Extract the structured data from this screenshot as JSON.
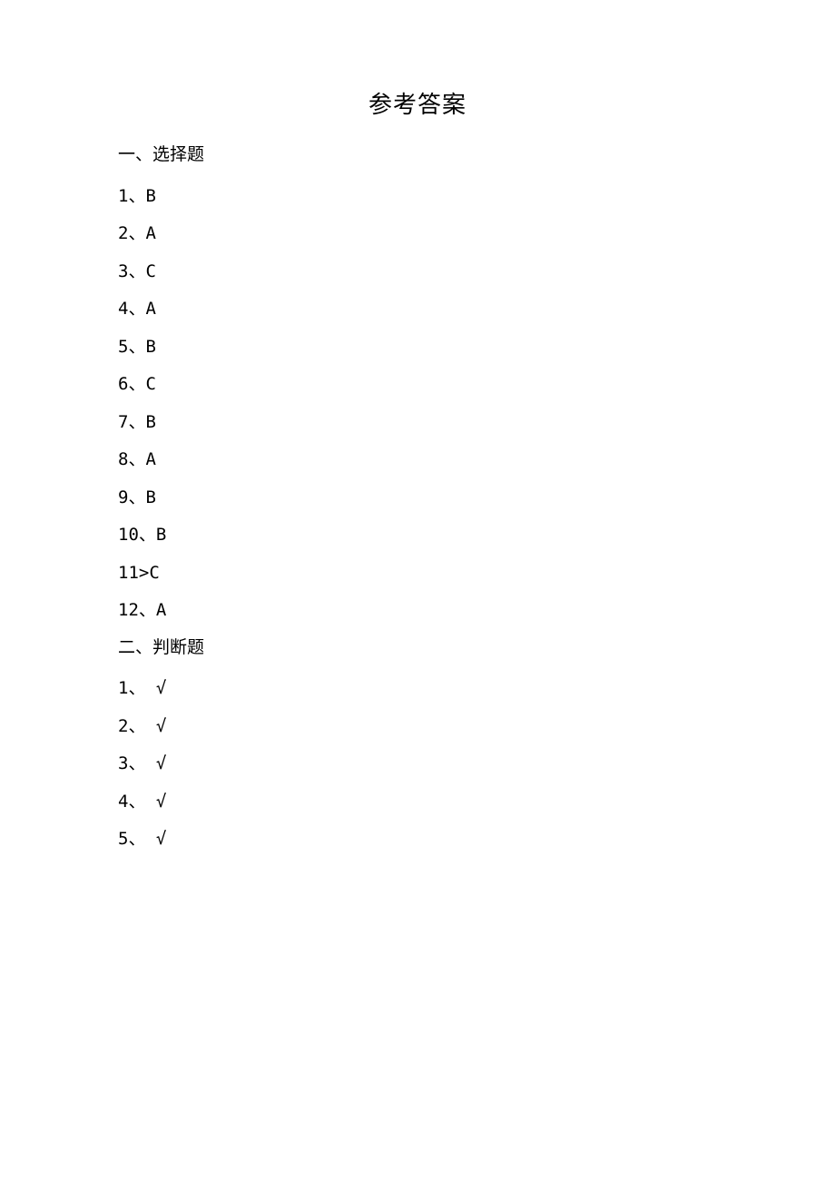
{
  "title": "参考答案",
  "sections": [
    {
      "heading": "一、选择题",
      "items": [
        "1、B",
        "2、A",
        "3、C",
        "4、A",
        "5、B",
        "6、C",
        "7、B",
        "8、A",
        "9、B",
        "10、B",
        "11>C",
        "12、A"
      ]
    },
    {
      "heading": "二、判断题",
      "items": [
        "1、 √",
        "2、 √",
        "3、 √",
        "4、 √",
        "5、 √"
      ]
    }
  ]
}
